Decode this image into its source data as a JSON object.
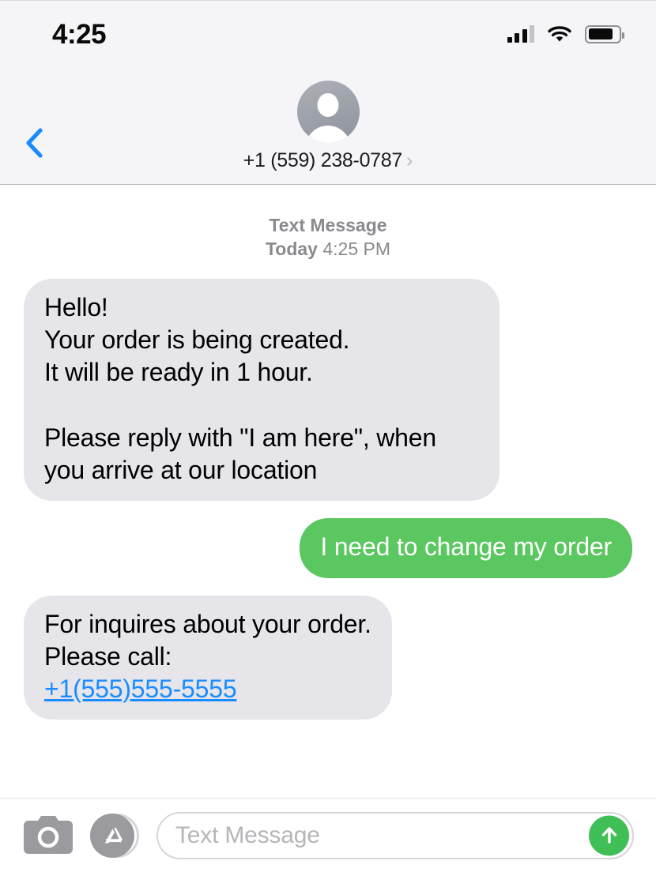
{
  "statusbar": {
    "time": "4:25",
    "signal_icon": "cellular-signal-icon",
    "wifi_icon": "wifi-icon",
    "battery_icon": "battery-icon",
    "signal_bars_filled": 3,
    "signal_bars_total": 4,
    "battery_level_percent": 82
  },
  "navbar": {
    "back_icon": "chevron-left-icon",
    "back_label": "",
    "avatar_icon": "person-avatar-icon",
    "contact_number": "+1 (559) 238-0787",
    "disclosure_icon": "chevron-right-icon",
    "disclosure_glyph": "›"
  },
  "conversation": {
    "meta_service": "Text Message",
    "meta_day": "Today",
    "meta_time": "4:25 PM",
    "messages": [
      {
        "direction": "in",
        "text": "Hello!\nYour order is being created.\nIt will be ready in 1 hour.\n\nPlease reply with \"I am here\", when you arrive at our location"
      },
      {
        "direction": "out",
        "text": "I need to change my order"
      },
      {
        "direction": "in",
        "text_before_link": "For inquires about your order.\nPlease call:\n",
        "link_text": "+1(555)555-5555"
      }
    ]
  },
  "inputbar": {
    "camera_icon": "camera-icon",
    "appstore_icon": "app-store-icon",
    "placeholder": "Text Message",
    "value": "",
    "send_icon": "send-arrow-up-icon"
  },
  "colors": {
    "accent_blue": "#1a8cff",
    "bubble_in": "#e5e5ea",
    "bubble_out": "#5bc760",
    "send_green": "#3fbf55",
    "header_bg": "#f5f5f7",
    "meta_gray": "#8a8a8e"
  }
}
